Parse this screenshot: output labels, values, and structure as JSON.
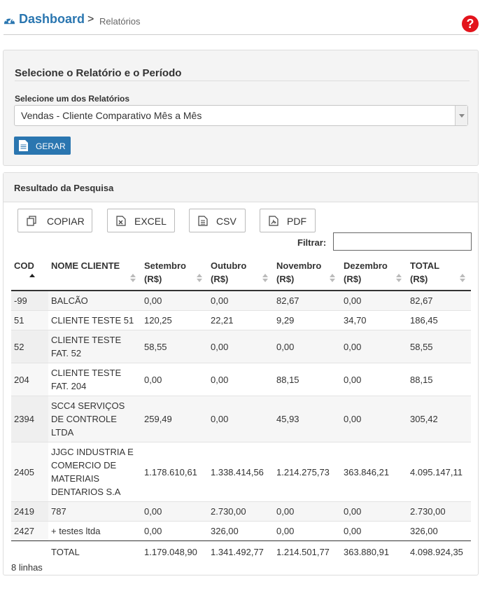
{
  "header": {
    "title": "Dashboard",
    "separator": ">",
    "current": "Relatórios",
    "help_glyph": "?",
    "icons": {
      "dashboard": "dashboard-gauge-icon",
      "help": "help-circle-icon"
    },
    "colors": {
      "title": "#2a76b0",
      "help": "#e3141c"
    }
  },
  "report_panel": {
    "title": "Selecione o Relatório e o Período",
    "select_label": "Selecione um dos Relatórios",
    "select_value": "Vendas - Cliente Comparativo Mês a Mês",
    "generate_label": "GERAR",
    "generate_color": "#2a76b0"
  },
  "results": {
    "title": "Resultado da Pesquisa",
    "export_buttons": {
      "copy": "COPIAR",
      "excel": "EXCEL",
      "csv": "CSV",
      "pdf": "PDF"
    },
    "filter_label": "Filtrar:",
    "filter_value": "",
    "columns": {
      "cod": "COD",
      "nome": "NOME CLIENTE",
      "set": [
        "Setembro",
        "(R$)"
      ],
      "out": [
        "Outubro",
        "(R$)"
      ],
      "nov": [
        "Novembro",
        "(R$)"
      ],
      "dez": [
        "Dezembro",
        "(R$)"
      ],
      "total": [
        "TOTAL",
        "(R$)"
      ]
    },
    "rows": [
      {
        "cod": "-99",
        "nome": "BALCÃO",
        "set": "0,00",
        "out": "0,00",
        "nov": "82,67",
        "dez": "0,00",
        "total": "82,67"
      },
      {
        "cod": "51",
        "nome": "CLIENTE TESTE 51",
        "set": "120,25",
        "out": "22,21",
        "nov": "9,29",
        "dez": "34,70",
        "total": "186,45"
      },
      {
        "cod": "52",
        "nome": "CLIENTE TESTE FAT. 52",
        "set": "58,55",
        "out": "0,00",
        "nov": "0,00",
        "dez": "0,00",
        "total": "58,55"
      },
      {
        "cod": "204",
        "nome": "CLIENTE TESTE FAT. 204",
        "set": "0,00",
        "out": "0,00",
        "nov": "88,15",
        "dez": "0,00",
        "total": "88,15"
      },
      {
        "cod": "2394",
        "nome": "SCC4 SERVIÇOS DE CONTROLE LTDA",
        "set": "259,49",
        "out": "0,00",
        "nov": "45,93",
        "dez": "0,00",
        "total": "305,42"
      },
      {
        "cod": "2405",
        "nome": "JJGC INDUSTRIA E COMERCIO DE MATERIAIS DENTARIOS S.A",
        "set": "1.178.610,61",
        "out": "1.338.414,56",
        "nov": "1.214.275,73",
        "dez": "363.846,21",
        "total": "4.095.147,11"
      },
      {
        "cod": "2419",
        "nome": "787",
        "set": "0,00",
        "out": "2.730,00",
        "nov": "0,00",
        "dez": "0,00",
        "total": "2.730,00"
      },
      {
        "cod": "2427",
        "nome": "+ testes ltda",
        "set": "0,00",
        "out": "326,00",
        "nov": "0,00",
        "dez": "0,00",
        "total": "326,00"
      }
    ],
    "footer": {
      "cod": "",
      "nome": "TOTAL",
      "set": "1.179.048,90",
      "out": "1.341.492,77",
      "nov": "1.214.501,77",
      "dez": "363.880,91",
      "total": "4.098.924,35"
    },
    "row_count": "8 linhas"
  }
}
